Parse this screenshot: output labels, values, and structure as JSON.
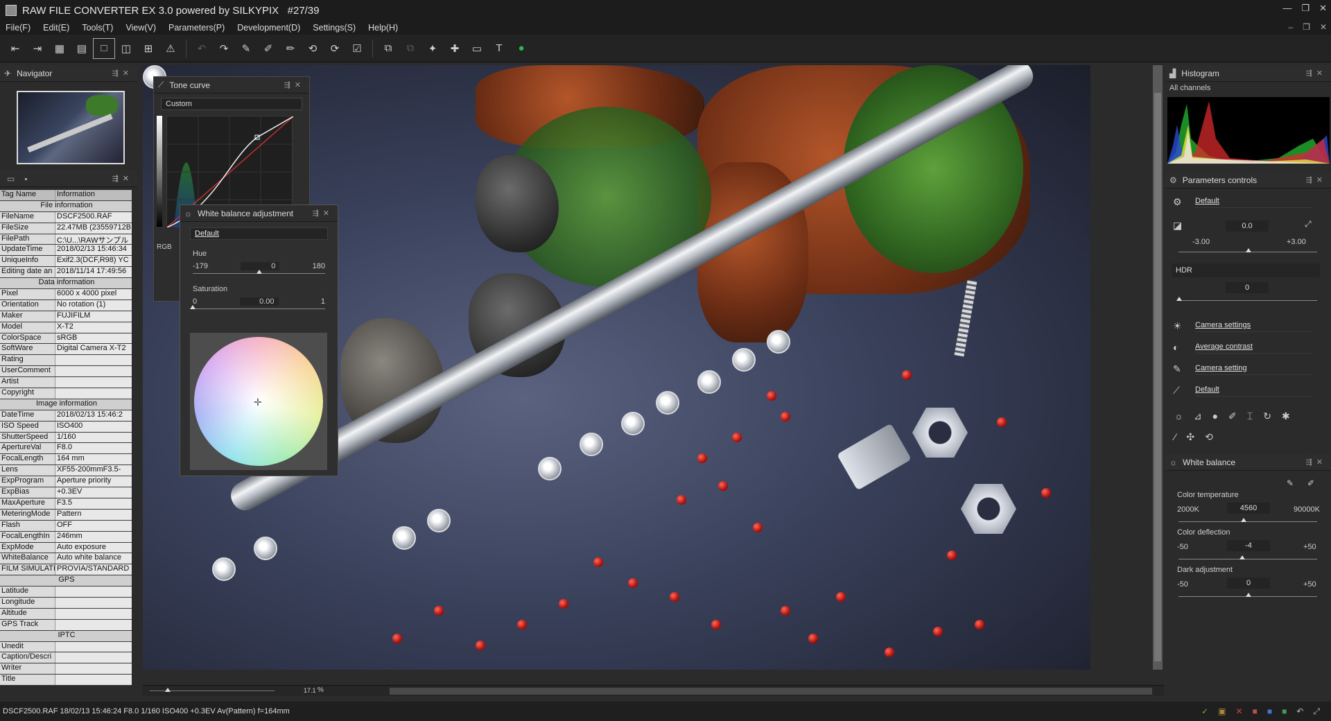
{
  "app": {
    "title": "RAW FILE CONVERTER EX 3.0 powered by SILKYPIX",
    "counter": "#27/39"
  },
  "menu": [
    "File(F)",
    "Edit(E)",
    "Tools(T)",
    "View(V)",
    "Parameters(P)",
    "Development(D)",
    "Settings(S)",
    "Help(H)"
  ],
  "navigator": {
    "title": "Navigator"
  },
  "info_table": {
    "col_tag": "Tag Name",
    "col_info": "Information",
    "rows": [
      {
        "section": "File information"
      },
      {
        "k": "FileName",
        "v": "DSCF2500.RAF"
      },
      {
        "k": "FileSize",
        "v": "22.47MB (23559712B"
      },
      {
        "k": "FilePath",
        "v": "C:\\U...\\RAWサンプル"
      },
      {
        "k": "UpdateTime",
        "v": "2018/02/13 15:46:34"
      },
      {
        "k": "UniqueInfo",
        "v": "Exif2.3(DCF,R98) YC"
      },
      {
        "k": "Editing date an",
        "v": "2018/11/14 17:49:56"
      },
      {
        "section": "Data information"
      },
      {
        "k": "Pixel",
        "v": "6000 x 4000 pixel"
      },
      {
        "k": "Orientation",
        "v": "No rotation (1)"
      },
      {
        "k": "Maker",
        "v": "FUJIFILM"
      },
      {
        "k": "Model",
        "v": "X-T2"
      },
      {
        "k": "ColorSpace",
        "v": "sRGB"
      },
      {
        "k": "SoftWare",
        "v": "Digital Camera X-T2"
      },
      {
        "k": "Rating",
        "v": ""
      },
      {
        "k": "UserComment",
        "v": ""
      },
      {
        "k": "Artist",
        "v": ""
      },
      {
        "k": "Copyright",
        "v": ""
      },
      {
        "section": "Image information"
      },
      {
        "k": "DateTime",
        "v": "2018/02/13 15:46:2"
      },
      {
        "k": "ISO Speed",
        "v": "ISO400"
      },
      {
        "k": "ShutterSpeed",
        "v": "1/160"
      },
      {
        "k": "ApertureVal",
        "v": "F8.0"
      },
      {
        "k": "FocalLength",
        "v": "164 mm"
      },
      {
        "k": "Lens",
        "v": "XF55-200mmF3.5-"
      },
      {
        "k": "ExpProgram",
        "v": "Aperture priority"
      },
      {
        "k": "ExpBias",
        "v": "+0.3EV"
      },
      {
        "k": "MaxAperture",
        "v": "F3.5"
      },
      {
        "k": "MeteringMode",
        "v": "Pattern"
      },
      {
        "k": "Flash",
        "v": "OFF"
      },
      {
        "k": "FocalLengthIn",
        "v": "246mm"
      },
      {
        "k": "ExpMode",
        "v": "Auto exposure"
      },
      {
        "k": "WhiteBalance",
        "v": "Auto white balance"
      },
      {
        "k": "FILM SIMULATI",
        "v": "PROVIA/STANDARD"
      },
      {
        "section": "GPS"
      },
      {
        "k": "Latitude",
        "v": ""
      },
      {
        "k": "Longitude",
        "v": ""
      },
      {
        "k": "Altitude",
        "v": ""
      },
      {
        "k": "GPS Track",
        "v": ""
      },
      {
        "section": "IPTC"
      },
      {
        "k": "Unedit",
        "v": ""
      },
      {
        "k": "Caption/Descri",
        "v": ""
      },
      {
        "k": "Writer",
        "v": ""
      },
      {
        "k": "Title",
        "v": ""
      }
    ]
  },
  "tone_curve": {
    "title": "Tone curve",
    "preset": "Custom",
    "channel": "RGB"
  },
  "wb_adjust": {
    "title": "White balance adjustment",
    "preset": "Default",
    "hue_label": "Hue",
    "hue_min": "-179",
    "hue_val": "0",
    "hue_max": "180",
    "sat_label": "Saturation",
    "sat_min": "0",
    "sat_val": "0.00",
    "sat_max": "1"
  },
  "histogram": {
    "title": "Histogram",
    "channel": "All channels"
  },
  "params": {
    "title": "Parameters controls",
    "preset": "Default",
    "exposure_val": "0.0",
    "exposure_min": "-3.00",
    "exposure_max": "+3.00",
    "hdr_label": "HDR",
    "hdr_val": "0",
    "items": [
      {
        "label": "Camera settings"
      },
      {
        "label": "Average contrast"
      },
      {
        "label": "Camera setting"
      },
      {
        "label": "Default"
      }
    ]
  },
  "white_balance": {
    "title": "White balance",
    "temp_label": "Color temperature",
    "temp_min": "2000K",
    "temp_val": "4560",
    "temp_max": "90000K",
    "defl_label": "Color deflection",
    "defl_min": "-50",
    "defl_val": "-4",
    "defl_max": "+50",
    "dark_label": "Dark adjustment",
    "dark_min": "-50",
    "dark_val": "0",
    "dark_max": "+50"
  },
  "zoom": {
    "value": "17.1",
    "unit": "%"
  },
  "status": "DSCF2500.RAF 18/02/13 15:46:24 F8.0 1/160 ISO400 +0.3EV Av(Pattern) f=164mm"
}
